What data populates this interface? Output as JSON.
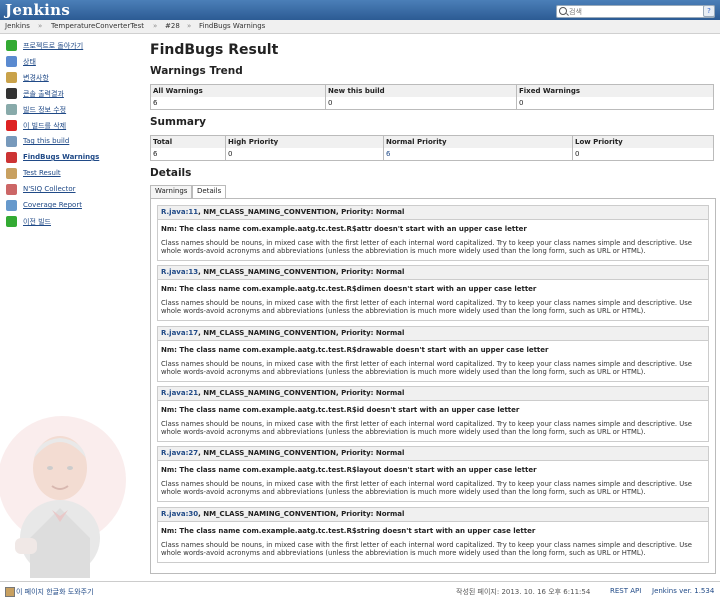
{
  "header": {
    "logo": "Jenkins",
    "search_placeholder": "검색",
    "help_icon": "help-icon"
  },
  "breadcrumbs": [
    "Jenkins",
    "TemperatureConverterTest",
    "#28",
    "FindBugs Warnings"
  ],
  "sidebar": [
    {
      "label": "프로젝트로 돌아가기",
      "icon": "up-arrow-icon",
      "color": "#3a3"
    },
    {
      "label": "상태",
      "icon": "notepad-icon",
      "color": "#5a8ad0"
    },
    {
      "label": "변경사항",
      "icon": "notepad-pencil-icon",
      "color": "#c9a24a"
    },
    {
      "label": "콘솔 출력결과",
      "icon": "terminal-icon",
      "color": "#333"
    },
    {
      "label": "빌드 정보 수정",
      "icon": "notepad-icon",
      "color": "#8aa"
    },
    {
      "label": "이 빌드를 삭제",
      "icon": "no-entry-icon",
      "color": "#d22"
    },
    {
      "label": "Tag this build",
      "icon": "save-icon",
      "color": "#79b"
    },
    {
      "label": "FindBugs Warnings",
      "icon": "bug-icon",
      "color": "#c33"
    },
    {
      "label": "Test Result",
      "icon": "clipboard-icon",
      "color": "#c8a060"
    },
    {
      "label": "N'SIQ Collector",
      "icon": "graph-icon",
      "color": "#c66"
    },
    {
      "label": "Coverage Report",
      "icon": "graph-icon",
      "color": "#69c"
    },
    {
      "label": "이전 빌드",
      "icon": "left-arrow-icon",
      "color": "#3a3"
    }
  ],
  "main": {
    "title": "FindBugs Result",
    "trend_heading": "Warnings Trend",
    "trend": {
      "headers": [
        "All Warnings",
        "New this build",
        "Fixed Warnings"
      ],
      "values": [
        "6",
        "0",
        "0"
      ]
    },
    "summary_heading": "Summary",
    "summary": {
      "headers": [
        "Total",
        "High Priority",
        "Normal Priority",
        "Low Priority"
      ],
      "values": [
        "6",
        "0",
        "6",
        "0"
      ]
    },
    "details_heading": "Details",
    "tabs": [
      "Warnings",
      "Details"
    ],
    "warnings": [
      {
        "file": "R.java:11",
        "rest": ", NM_CLASS_NAMING_CONVENTION, Priority: Normal",
        "msg": "Nm: The class name com.example.aatg.tc.test.R$attr doesn't start with an upper case letter"
      },
      {
        "file": "R.java:13",
        "rest": ", NM_CLASS_NAMING_CONVENTION, Priority: Normal",
        "msg": "Nm: The class name com.example.aatg.tc.test.R$dimen doesn't start with an upper case letter"
      },
      {
        "file": "R.java:17",
        "rest": ", NM_CLASS_NAMING_CONVENTION, Priority: Normal",
        "msg": "Nm: The class name com.example.aatg.tc.test.R$drawable doesn't start with an upper case letter"
      },
      {
        "file": "R.java:21",
        "rest": ", NM_CLASS_NAMING_CONVENTION, Priority: Normal",
        "msg": "Nm: The class name com.example.aatg.tc.test.R$id doesn't start with an upper case letter"
      },
      {
        "file": "R.java:27",
        "rest": ", NM_CLASS_NAMING_CONVENTION, Priority: Normal",
        "msg": "Nm: The class name com.example.aatg.tc.test.R$layout doesn't start with an upper case letter"
      },
      {
        "file": "R.java:30",
        "rest": ", NM_CLASS_NAMING_CONVENTION, Priority: Normal",
        "msg": "Nm: The class name com.example.aatg.tc.test.R$string doesn't start with an upper case letter"
      }
    ],
    "description": "Class names should be nouns, in mixed case with the first letter of each internal word capitalized. Try to keep your class names simple and descriptive. Use whole words-avoid acronyms and abbreviations (unless the abbreviation is much more widely used than the long form, such as URL or HTML)."
  },
  "footer": {
    "translate": "이 페이지 한글화 도와주기",
    "generated": "작성된 페이지: 2013. 10. 16 오후 6:11:54",
    "rest_api": "REST API",
    "version": "Jenkins ver. 1.534"
  }
}
